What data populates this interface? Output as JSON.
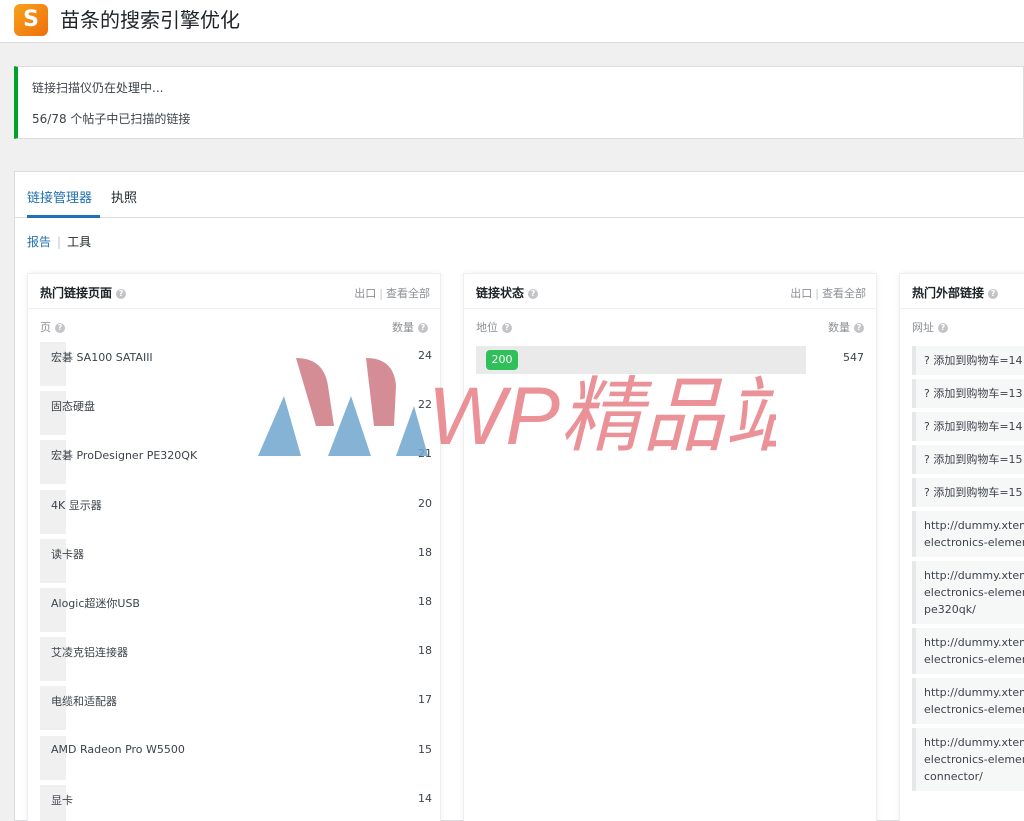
{
  "app": {
    "logo_letter": "S",
    "title": "苗条的搜索引擎优化"
  },
  "notice": {
    "line1": "链接扫描仪仍在处理中...",
    "line2": "56/78 个帖子中已扫描的链接"
  },
  "tabs": [
    {
      "label": "链接管理器",
      "active": true
    },
    {
      "label": "执照",
      "active": false
    }
  ],
  "subnav": {
    "report": "报告",
    "separator": "|",
    "tools": "工具"
  },
  "card_top_pages": {
    "title": "热门链接页面",
    "export": "出口",
    "separator": "|",
    "view_all": "查看全部",
    "col_page": "页",
    "col_count": "数量",
    "rows": [
      {
        "label": "宏碁 SA100 SATAIII",
        "count": "24"
      },
      {
        "label": "固态硬盘",
        "count": "22"
      },
      {
        "label": "宏碁 ProDesigner PE320QK",
        "count": "21"
      },
      {
        "label": "4K 显示器",
        "count": "20"
      },
      {
        "label": "读卡器",
        "count": "18"
      },
      {
        "label": "Alogic超迷你USB",
        "count": "18"
      },
      {
        "label": "艾凌克铝连接器",
        "count": "18"
      },
      {
        "label": "电缆和适配器",
        "count": "17"
      },
      {
        "label": "AMD Radeon Pro W5500",
        "count": "15"
      },
      {
        "label": "显卡",
        "count": "14"
      }
    ]
  },
  "card_link_status": {
    "title": "链接状态",
    "export": "出口",
    "separator": "|",
    "view_all": "查看全部",
    "col_status": "地位",
    "col_count": "数量",
    "badge": "200",
    "count": "547"
  },
  "card_external": {
    "title": "热门外部链接",
    "col_url": "网址",
    "items": [
      [
        "? 添加到购物车=14"
      ],
      [
        "? 添加到购物车=13"
      ],
      [
        "? 添加到购物车=14"
      ],
      [
        "? 添加到购物车=15"
      ],
      [
        "? 添加到购物车=15"
      ],
      [
        "http://dummy.xtem",
        "electronics-element"
      ],
      [
        "http://dummy.xtem",
        "electronics-element",
        "pe320qk/"
      ],
      [
        "http://dummy.xtem",
        "electronics-element"
      ],
      [
        "http://dummy.xtem",
        "electronics-element"
      ],
      [
        "http://dummy.xtem",
        "electronics-element",
        "connector/"
      ]
    ]
  },
  "watermark": {
    "text": "WP精品站"
  },
  "colors": {
    "accent": "#2271b1",
    "success": "#00a32a",
    "badge_green": "#2fbf5b",
    "logo_orange": "#f28c12"
  }
}
